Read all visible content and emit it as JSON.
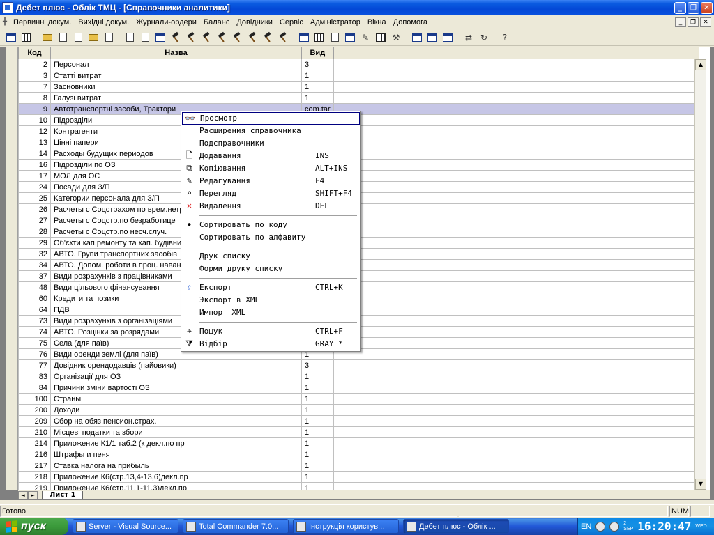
{
  "window": {
    "title": "Дебет плюс - Облік ТМЦ - [Справочники аналитики]"
  },
  "menu": [
    "Первинні докум.",
    "Вихідні докум.",
    "Журнали-ордери",
    "Баланс",
    "Довідники",
    "Сервіс",
    "Адміністратор",
    "Вікна",
    "Допомога"
  ],
  "table": {
    "headers": {
      "code": "Код",
      "name": "Назва",
      "kind": "Вид"
    },
    "rows": [
      {
        "code": "2",
        "name": "Персонал",
        "kind": "3"
      },
      {
        "code": "3",
        "name": "Статті витрат",
        "kind": "1"
      },
      {
        "code": "7",
        "name": "Засновники",
        "kind": "1"
      },
      {
        "code": "8",
        "name": "Галузі витрат",
        "kind": "1"
      },
      {
        "code": "9",
        "name": "Автотранспортні засоби, Трактори",
        "kind": "com.tar"
      },
      {
        "code": "10",
        "name": "Підрозділи",
        "kind": ""
      },
      {
        "code": "12",
        "name": "Контрагенти",
        "kind": ""
      },
      {
        "code": "13",
        "name": "Цінні папери",
        "kind": ""
      },
      {
        "code": "14",
        "name": "Расходы будущих периодов",
        "kind": ""
      },
      {
        "code": "16",
        "name": "Підрозділи по ОЗ",
        "kind": ""
      },
      {
        "code": "17",
        "name": "МОЛ для ОС",
        "kind": ""
      },
      {
        "code": "24",
        "name": "Посади для З/П",
        "kind": ""
      },
      {
        "code": "25",
        "name": "Категории персонала для З/П",
        "kind": ""
      },
      {
        "code": "26",
        "name": "Расчеты с Соцстрахом по врем.нетр",
        "kind": ""
      },
      {
        "code": "27",
        "name": "Расчеты с Соцстр.по безработице",
        "kind": ""
      },
      {
        "code": "28",
        "name": "Расчеты с Соцстр.по несч.случ.",
        "kind": ""
      },
      {
        "code": "29",
        "name": "Об'єкти кап.ремонту та кап. будівниц",
        "kind": ""
      },
      {
        "code": "32",
        "name": "АВТО. Групи транспортних засобів",
        "kind": ""
      },
      {
        "code": "34",
        "name": "АВТО. Допом. роботи в проц. наван",
        "kind": ""
      },
      {
        "code": "37",
        "name": "Види розрахунків з працівниками",
        "kind": ""
      },
      {
        "code": "48",
        "name": "Види цільового фінансування",
        "kind": ""
      },
      {
        "code": "60",
        "name": "Кредити та позики",
        "kind": ""
      },
      {
        "code": "64",
        "name": "ПДВ",
        "kind": ""
      },
      {
        "code": "73",
        "name": "Види розрахунків з організаціями",
        "kind": ""
      },
      {
        "code": "74",
        "name": "АВТО. Розцінки за розрядами",
        "kind": ""
      },
      {
        "code": "75",
        "name": "Села (для паїв)",
        "kind": ""
      },
      {
        "code": "76",
        "name": "Види оренди землі (для паїв)",
        "kind": "1"
      },
      {
        "code": "77",
        "name": "Довідник орендодавців (пайовики)",
        "kind": "3"
      },
      {
        "code": "83",
        "name": "Організації для ОЗ",
        "kind": "1"
      },
      {
        "code": "84",
        "name": "Причини зміни вартості ОЗ",
        "kind": "1"
      },
      {
        "code": "100",
        "name": "Страны",
        "kind": "1"
      },
      {
        "code": "200",
        "name": "Доходи",
        "kind": "1"
      },
      {
        "code": "209",
        "name": "Сбор на обяз.пенсион.страх.",
        "kind": "1"
      },
      {
        "code": "210",
        "name": "Місцеві податки та збори",
        "kind": "1"
      },
      {
        "code": "214",
        "name": "Приложение К1/1 таб.2 (к декл.по пр",
        "kind": "1"
      },
      {
        "code": "216",
        "name": "Штрафы и пеня",
        "kind": "1"
      },
      {
        "code": "217",
        "name": "Ставка налога на прибыль",
        "kind": "1"
      },
      {
        "code": "218",
        "name": "Приложение К6(стр.13,4-13,6)декл.пр",
        "kind": "1"
      },
      {
        "code": "219",
        "name": "Приложение К6(стр.11,1-11,3)декл.пр",
        "kind": "1"
      }
    ]
  },
  "sheet_tab": "Лист 1",
  "context_menu": [
    {
      "type": "item",
      "icon": "glasses-icon",
      "label": "Просмотр",
      "key": "",
      "highlighted": true
    },
    {
      "type": "item",
      "icon": "",
      "label": "Расширения справочника",
      "key": ""
    },
    {
      "type": "item",
      "icon": "",
      "label": "Подсправочники",
      "key": ""
    },
    {
      "type": "item",
      "icon": "new-doc-icon",
      "label": "Додавання",
      "key": "INS"
    },
    {
      "type": "item",
      "icon": "copy-icon",
      "label": "Копіювання",
      "key": "ALT+INS"
    },
    {
      "type": "item",
      "icon": "edit-icon",
      "label": "Редагування",
      "key": "F4"
    },
    {
      "type": "item",
      "icon": "view-icon",
      "label": "Перегляд",
      "key": "SHIFT+F4"
    },
    {
      "type": "item",
      "icon": "delete-icon",
      "label": "Видалення",
      "key": "DEL"
    },
    {
      "type": "sep"
    },
    {
      "type": "item",
      "icon": "bullet-icon",
      "label": "Сортировать по коду",
      "key": ""
    },
    {
      "type": "item",
      "icon": "",
      "label": "Сортировать по алфавиту",
      "key": ""
    },
    {
      "type": "sep"
    },
    {
      "type": "item",
      "icon": "",
      "label": "Друк списку",
      "key": ""
    },
    {
      "type": "item",
      "icon": "",
      "label": "Форми друку списку",
      "key": ""
    },
    {
      "type": "sep"
    },
    {
      "type": "item",
      "icon": "export-icon",
      "label": "Експорт",
      "key": "CTRL+K"
    },
    {
      "type": "item",
      "icon": "",
      "label": "Экспорт в XML",
      "key": ""
    },
    {
      "type": "item",
      "icon": "",
      "label": "Импорт XML",
      "key": ""
    },
    {
      "type": "sep"
    },
    {
      "type": "item",
      "icon": "binoculars-icon",
      "label": "Пошук",
      "key": "CTRL+F"
    },
    {
      "type": "item",
      "icon": "filter-icon",
      "label": "Відбір",
      "key": "GRAY *"
    }
  ],
  "status": {
    "text": "Готово",
    "num": "NUM"
  },
  "taskbar": {
    "start": "пуск",
    "tasks": [
      "Server - Visual Source...",
      "Total Commander 7.0...",
      "Інструкція користув...",
      "Дебет плюс - Облік ..."
    ],
    "lang": "EN",
    "clock": "16:20:47",
    "day": "2",
    "month": "SEP",
    "weekday": "WED"
  }
}
